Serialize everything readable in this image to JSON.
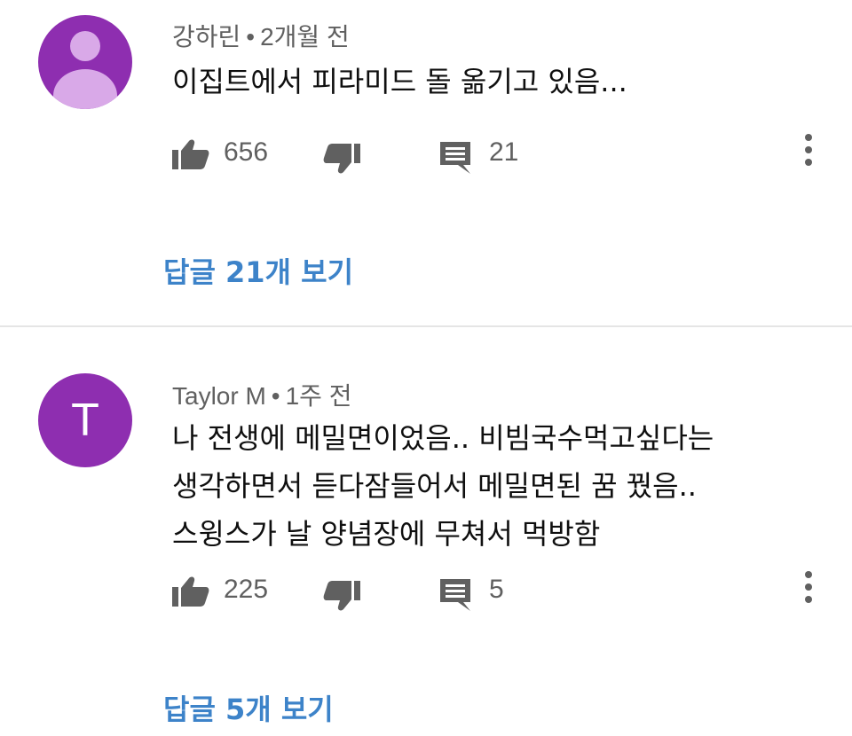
{
  "comments": [
    {
      "author": "강하린",
      "time": "2개월 전",
      "text": "이집트에서 피라미드 돌 옮기고 있음...",
      "likes": "656",
      "reply_count": "21",
      "view_replies": "답글 21개 보기",
      "avatar_type": "default-person-icon",
      "avatar_letter": ""
    },
    {
      "author": "Taylor M",
      "time": "1주 전",
      "text": "나 전생에 메밀면이었음.. 비빔국수먹고싶다는\n생각하면서 듣다잠들어서 메밀면된 꿈 꿨음..\n스윙스가 날 양념장에 무쳐서 먹방함",
      "likes": "225",
      "reply_count": "5",
      "view_replies": "답글 5개 보기",
      "avatar_type": "letter",
      "avatar_letter": "T"
    }
  ],
  "meta_separator": "•",
  "colors": {
    "avatar_bg": "#8e2eb0",
    "link": "#3d83c9",
    "icon": "#606060"
  },
  "icons": [
    "like-icon",
    "dislike-icon",
    "reply-icon",
    "more-options-icon"
  ]
}
